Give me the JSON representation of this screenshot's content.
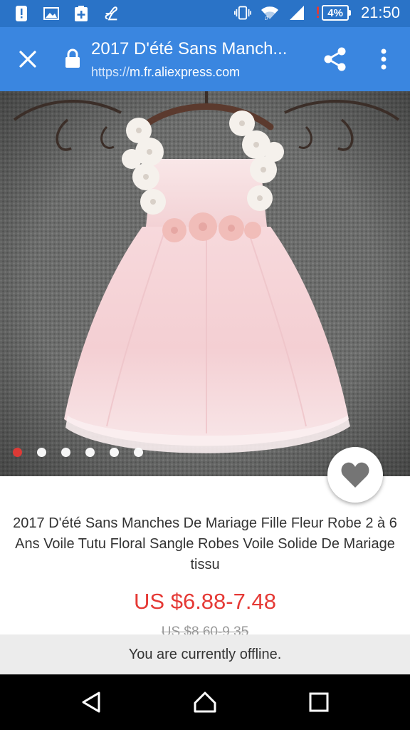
{
  "status_bar": {
    "left_icons": [
      "alert-icon",
      "image-icon",
      "add-icon",
      "lyca-icon"
    ],
    "right_icons": [
      "vibrate-icon",
      "wifi-icon",
      "signal-icon"
    ],
    "battery": "4%",
    "time": "21:50",
    "colors": {
      "bar": "#2a73c7",
      "warn": "#e53935"
    }
  },
  "toolbar": {
    "title": "2017 D'été Sans Manch...",
    "url_scheme": "https://",
    "url_host": "m.fr.aliexpress.com",
    "color": "#3a86e0"
  },
  "gallery": {
    "image_count": 6,
    "active_index": 0,
    "image_alt": "pink-lace-tutu-dress"
  },
  "product": {
    "title": "2017 D'été Sans Manches De Mariage Fille Fleur Robe 2 à 6 Ans Voile Tutu Floral Sangle Robes Voile Solide De Mariage tissu",
    "price": "US $6.88-7.48",
    "old_price": "US $8.60-9.35",
    "price_color": "#e53935"
  },
  "offline_banner": {
    "text": "You are currently offline."
  },
  "nav_bar": {
    "buttons": [
      "back-icon",
      "home-icon",
      "recents-icon"
    ]
  }
}
